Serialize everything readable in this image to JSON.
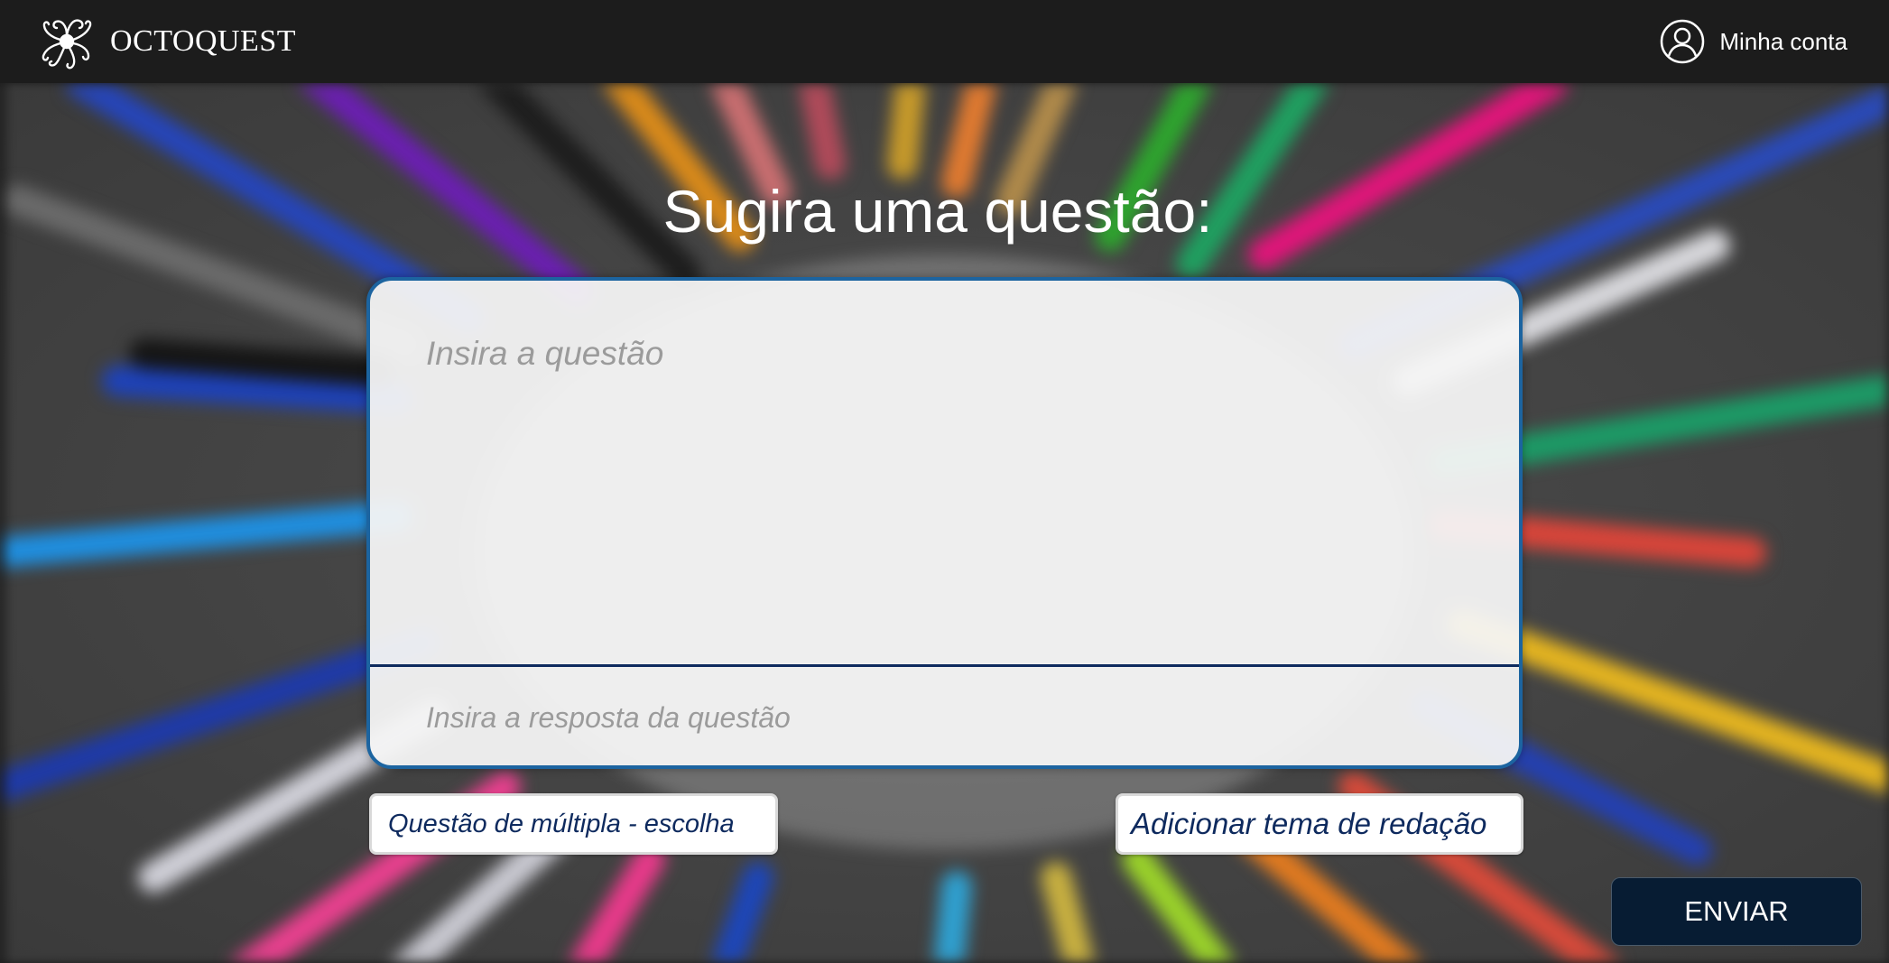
{
  "header": {
    "brand_name": "OCTOQUEST",
    "account_label": "Minha conta"
  },
  "main": {
    "heading": "Sugira uma questão:",
    "question_placeholder": "Insira a questão",
    "answer_placeholder": "Insira a resposta da questão",
    "multiple_choice_label": "Questão de múltipla - escolha",
    "essay_theme_label": "Adicionar tema de redação",
    "submit_label": "ENVIAR"
  },
  "colors": {
    "topbar": "#1c1c1c",
    "card_border": "#1c64a0",
    "divider": "#0e2a5e",
    "option_text": "#0e2a5e",
    "submit_background": "#071c33"
  }
}
